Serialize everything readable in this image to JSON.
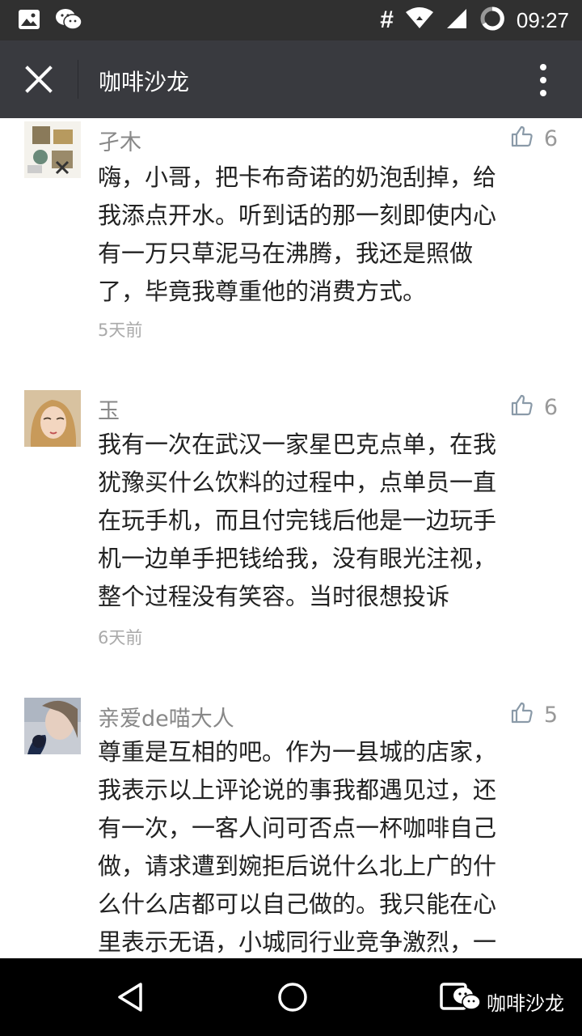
{
  "status_bar": {
    "time": "09:27",
    "hash": "#",
    "icons": [
      "image-icon",
      "wechat-icon",
      "wifi-icon",
      "signal-icon",
      "battery-icon"
    ]
  },
  "app_bar": {
    "title": "咖啡沙龙",
    "close_icon": "close-icon",
    "more_icon": "more-vertical-icon"
  },
  "comments": [
    {
      "nickname": "孑木",
      "likes": "6",
      "text_lines": [
        "嗨，小哥，把卡布奇诺的奶泡刮掉，给",
        "我添点开水。听到话的那一刻即使内心",
        "有一万只草泥马在沸腾，我还是照做",
        "了，毕竟我尊重他的消费方式。"
      ],
      "time": "5天前"
    },
    {
      "nickname": "玉",
      "likes": "6",
      "text_lines": [
        "我有一次在武汉一家星巴克点单，在我",
        "犹豫买什么饮料的过程中，点单员一直",
        "在玩手机，而且付完钱后他是一边玩手",
        "机一边单手把钱给我，没有眼光注视，",
        "整个过程没有笑容。当时很想投诉"
      ],
      "time": "6天前"
    },
    {
      "nickname": "亲爱de喵大人",
      "likes": "5",
      "text_lines": [
        "尊重是互相的吧。作为一县城的店家，",
        "我表示以上评论说的事我都遇见过，还",
        "有一次，一客人问可否点一杯咖啡自己",
        "做，请求遭到婉拒后说什么北上广的什",
        "么什么店都可以自己做的。我只能在心",
        "里表示无语，小城同行业竞争激烈，一"
      ],
      "time": ""
    }
  ],
  "nav_bar": {
    "watermark": "咖啡沙龙"
  },
  "colors": {
    "status_bar": "#303030",
    "app_bar": "#393a3f",
    "nav_bar": "#000000",
    "nickname": "#888888",
    "like": "#999999"
  }
}
